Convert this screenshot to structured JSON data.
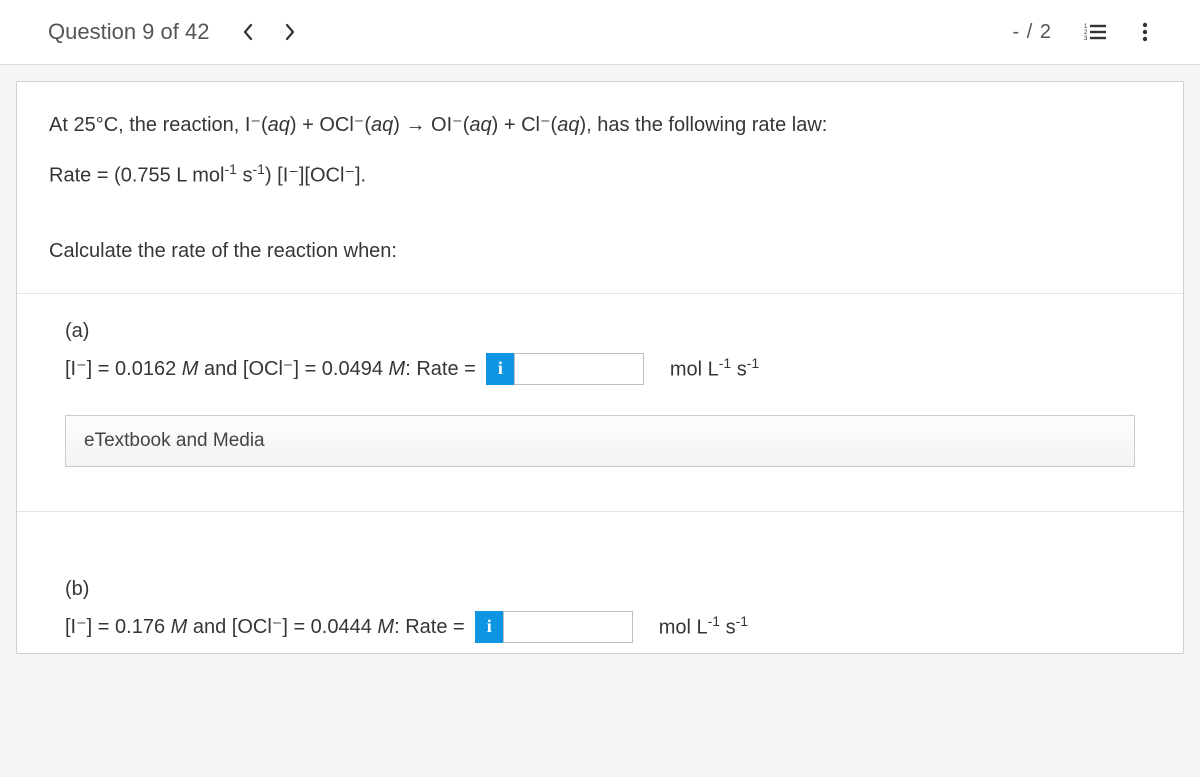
{
  "header": {
    "title": "Question 9 of 42",
    "score": "- / 2"
  },
  "prompt": {
    "calc_line": "Calculate the rate of the reaction when:"
  },
  "parts": {
    "a": {
      "label": "(a)",
      "input_value": ""
    },
    "b": {
      "label": "(b)",
      "input_value": ""
    }
  },
  "buttons": {
    "etextbook": "eTextbook and Media"
  },
  "info_glyph": "i"
}
